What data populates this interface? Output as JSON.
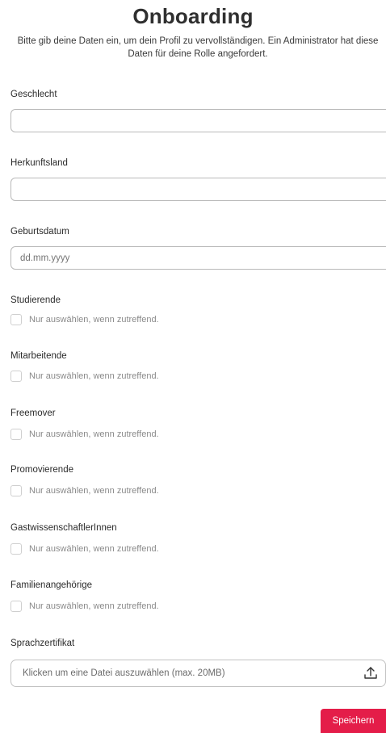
{
  "header": {
    "title": "Onboarding",
    "intro": "Bitte gib deine Daten ein, um dein Profil zu vervollständigen. Ein Administrator hat diese Daten für deine Rolle angefordert."
  },
  "fields": {
    "gender": {
      "label": "Geschlecht",
      "value": ""
    },
    "country": {
      "label": "Herkunftsland",
      "value": ""
    },
    "birthdate": {
      "label": "Geburtsdatum",
      "placeholder": "dd.mm.yyyy"
    }
  },
  "checkboxes": [
    {
      "label": "Studierende",
      "hint": "Nur auswählen, wenn zutreffend.",
      "checked": false
    },
    {
      "label": "Mitarbeitende",
      "hint": "Nur auswählen, wenn zutreffend.",
      "checked": false
    },
    {
      "label": "Freemover",
      "hint": "Nur auswählen, wenn zutreffend.",
      "checked": false
    },
    {
      "label": "Promovierende",
      "hint": "Nur auswählen, wenn zutreffend.",
      "checked": false
    },
    {
      "label": "GastwissenschaftlerInnen",
      "hint": "Nur auswählen, wenn zutreffend.",
      "checked": false
    },
    {
      "label": "Familienangehörige",
      "hint": "Nur auswählen, wenn zutreffend.",
      "checked": false
    }
  ],
  "certificate": {
    "label": "Sprachzertifikat",
    "placeholder": "Klicken um eine Datei auszuwählen (max. 20MB)",
    "icon": "upload-icon"
  },
  "actions": {
    "save_label": "Speichern",
    "save_color": "#e41d49"
  }
}
